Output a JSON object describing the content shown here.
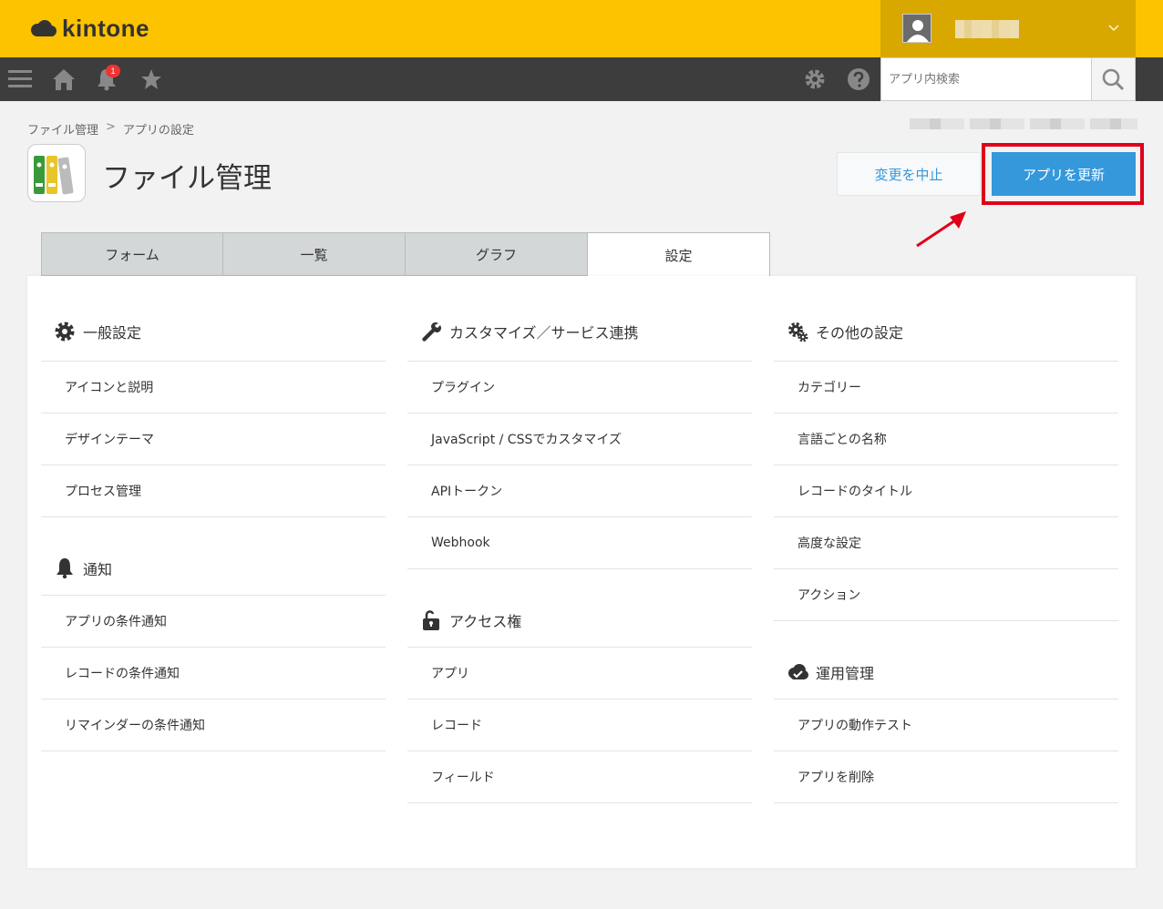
{
  "header": {
    "logo_text": "kintone",
    "badge_count": "1"
  },
  "search": {
    "placeholder": "アプリ内検索"
  },
  "breadcrumb": {
    "items": [
      "ファイル管理",
      "アプリの設定"
    ],
    "separator": ">"
  },
  "page": {
    "title": "ファイル管理"
  },
  "actions": {
    "cancel_label": "変更を中止",
    "update_label": "アプリを更新"
  },
  "tabs": [
    {
      "label": "フォーム",
      "active": false
    },
    {
      "label": "一覧",
      "active": false
    },
    {
      "label": "グラフ",
      "active": false
    },
    {
      "label": "設定",
      "active": true
    }
  ],
  "sections": {
    "general": {
      "title": "一般設定",
      "items": [
        "アイコンと説明",
        "デザインテーマ",
        "プロセス管理"
      ]
    },
    "notification": {
      "title": "通知",
      "items": [
        "アプリの条件通知",
        "レコードの条件通知",
        "リマインダーの条件通知"
      ]
    },
    "customize": {
      "title": "カスタマイズ／サービス連携",
      "items": [
        "プラグイン",
        "JavaScript / CSSでカスタマイズ",
        "APIトークン",
        "Webhook"
      ]
    },
    "access": {
      "title": "アクセス権",
      "items": [
        "アプリ",
        "レコード",
        "フィールド"
      ]
    },
    "other": {
      "title": "その他の設定",
      "items": [
        "カテゴリー",
        "言語ごとの名称",
        "レコードのタイトル",
        "高度な設定",
        "アクション"
      ]
    },
    "operation": {
      "title": "運用管理",
      "items": [
        "アプリの動作テスト",
        "アプリを削除"
      ]
    }
  },
  "colors": {
    "header_yellow": "#fec300",
    "nav_dark": "#3d3d3d",
    "accent_blue": "#3498db",
    "highlight_red": "#e0001a"
  }
}
